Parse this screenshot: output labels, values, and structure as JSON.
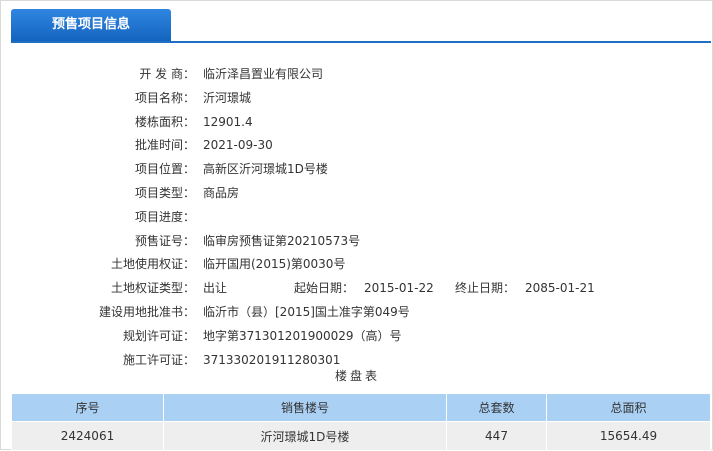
{
  "tab": {
    "label": "预售项目信息"
  },
  "info": {
    "developer": {
      "label": "开 发 商：",
      "value": "临沂泽昌置业有限公司"
    },
    "project_name": {
      "label": "项目名称：",
      "value": "沂河璟城"
    },
    "building_area": {
      "label": "楼栋面积：",
      "value": "12901.4"
    },
    "approval_date": {
      "label": "批准时间：",
      "value": "2021-09-30"
    },
    "project_location": {
      "label": "项目位置：",
      "value": "高新区沂河璟城1D号楼"
    },
    "project_type": {
      "label": "项目类型：",
      "value": "商品房"
    },
    "project_progress": {
      "label": "项目进度：",
      "value": ""
    },
    "presale_cert": {
      "label": "预售证号：",
      "value": "临审房预售证第20210573号"
    },
    "land_use_cert": {
      "label": "土地使用权证：",
      "value": "临开国用(2015)第0030号"
    },
    "land_cert_type": {
      "label": "土地权证类型：",
      "value": "出让",
      "start_label": "起始日期：",
      "start_value": "2015-01-22",
      "end_label": "终止日期：",
      "end_value": "2085-01-21"
    },
    "land_approval": {
      "label": "建设用地批准书：",
      "value": "临沂市（县）[2015]国土准字第049号"
    },
    "planning_permit": {
      "label": "规划许可证：",
      "value": "地字第371301201900029（高）号"
    },
    "construction_permit": {
      "label": "施工许可证：",
      "value": "371330201911280301"
    }
  },
  "table": {
    "title": "楼盘表",
    "headers": [
      "序号",
      "销售楼号",
      "总套数",
      "总面积"
    ],
    "rows": [
      [
        "2424061",
        "沂河璟城1D号楼",
        "447",
        "15654.49"
      ]
    ]
  },
  "colors": {
    "tab_bg": "#1f6fc3",
    "table_header_bg": "#aad0f4",
    "table_row_bg": "#eeeeee"
  }
}
